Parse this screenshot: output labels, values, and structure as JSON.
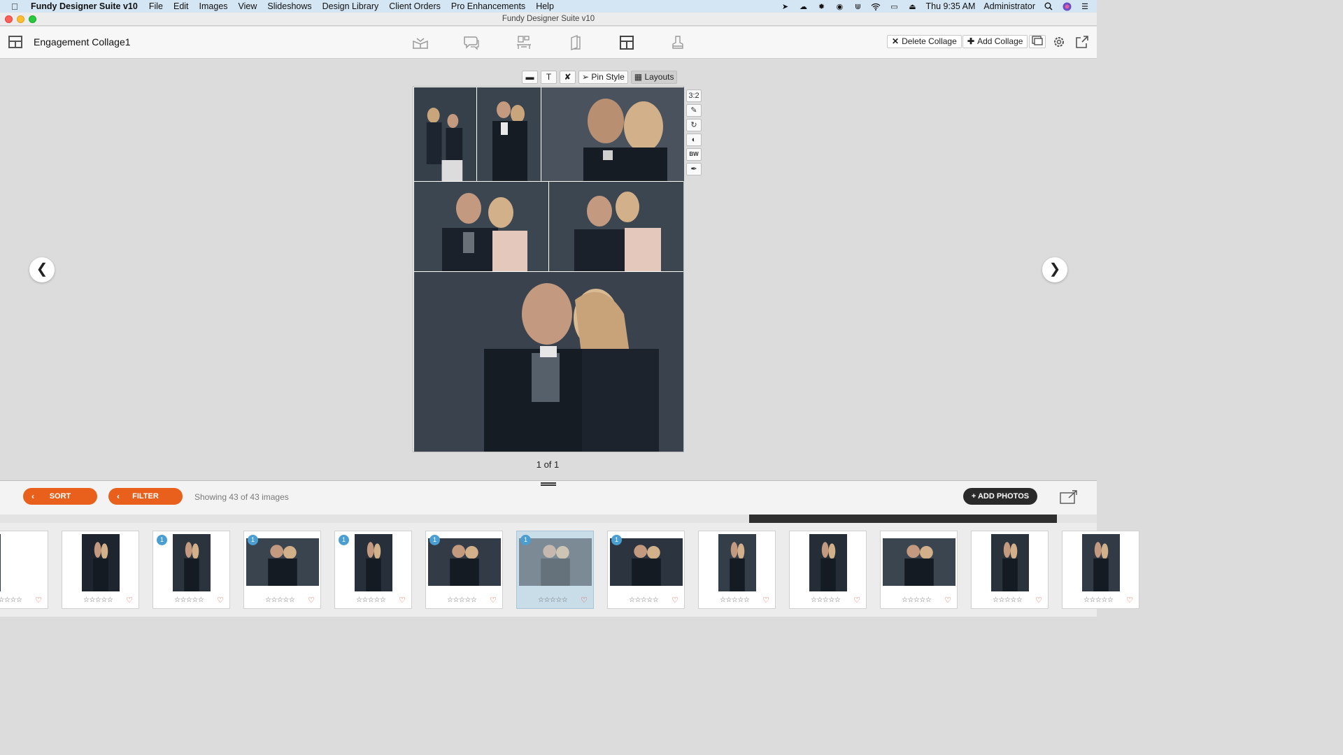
{
  "menubar": {
    "app_name": "Fundy Designer Suite v10",
    "menus": [
      "File",
      "Edit",
      "Images",
      "View",
      "Slideshows",
      "Design Library",
      "Client Orders",
      "Pro Enhancements",
      "Help"
    ],
    "clock": "Thu 9:35 AM",
    "user": "Administrator"
  },
  "window": {
    "title": "Fundy Designer Suite v10"
  },
  "toolbar": {
    "doc_title": "Engagement Collage1",
    "delete_label": "Delete Collage",
    "add_label": "Add Collage",
    "active_mode": "collage"
  },
  "edit_toolbar": {
    "pin_style_label": "Pin Style",
    "layouts_label": "Layouts"
  },
  "side_tools": {
    "ratio_label": "3:2",
    "bw_label": "BW"
  },
  "page_indicator": "1 of 1",
  "filter_bar": {
    "sort_label": "SORT",
    "filter_label": "FILTER",
    "showing_text": "Showing 43 of 43 images",
    "add_photos_label": "+ ADD PHOTOS"
  },
  "filmstrip": {
    "stars": "☆☆☆☆☆",
    "heart": "♡",
    "thumbs": [
      {
        "badge": "",
        "selected": false
      },
      {
        "badge": "",
        "selected": false
      },
      {
        "badge": "1",
        "selected": false
      },
      {
        "badge": "1",
        "selected": false
      },
      {
        "badge": "1",
        "selected": false
      },
      {
        "badge": "1",
        "selected": false
      },
      {
        "badge": "1",
        "selected": true
      },
      {
        "badge": "1",
        "selected": false
      },
      {
        "badge": "",
        "selected": false
      },
      {
        "badge": "",
        "selected": false
      },
      {
        "badge": "",
        "selected": false
      },
      {
        "badge": "",
        "selected": false
      },
      {
        "badge": "",
        "selected": false
      }
    ]
  },
  "colors": {
    "accent_orange": "#e8601c",
    "badge_blue": "#4a9ed1",
    "heart_red": "#e0442c",
    "dark_button": "#2a2a2a"
  }
}
